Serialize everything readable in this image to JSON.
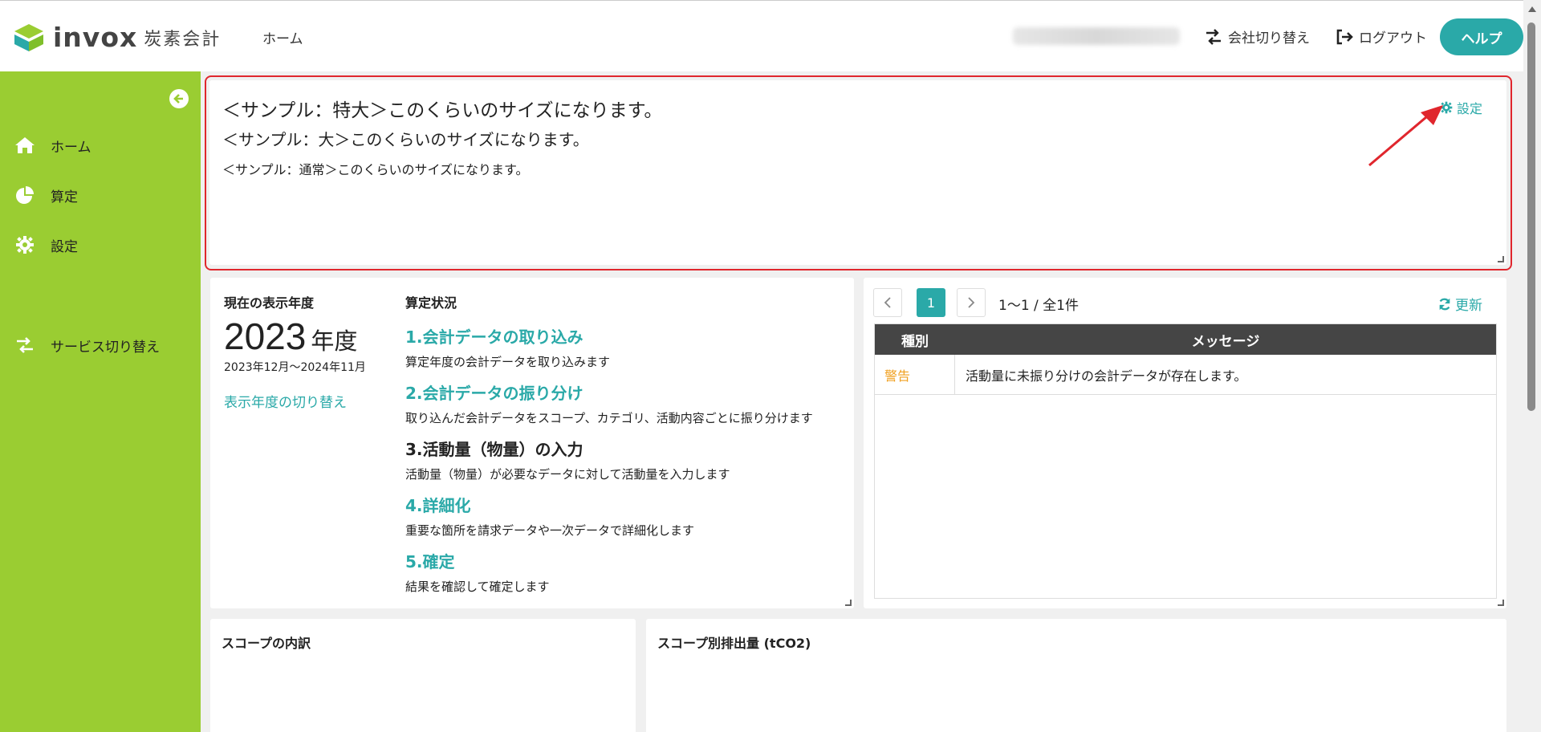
{
  "header": {
    "logo_text": "invox",
    "logo_sub": "炭素会計",
    "nav_home": "ホーム",
    "company_switch": "会社切り替え",
    "logout": "ログアウト",
    "help": "ヘルプ"
  },
  "sidebar": {
    "items": [
      {
        "label": "ホーム",
        "icon": "home-icon"
      },
      {
        "label": "算定",
        "icon": "pie-chart-icon"
      },
      {
        "label": "設定",
        "icon": "gear-icon"
      },
      {
        "label": "サービス切り替え",
        "icon": "switch-icon"
      }
    ]
  },
  "notice": {
    "sample_xl": "＜サンプル：特大＞このくらいのサイズになります。",
    "sample_lg": "＜サンプル：大＞このくらいのサイズになります。",
    "sample_normal": "＜サンプル：通常＞このくらいのサイズになります。",
    "settings_label": "設定"
  },
  "year_panel": {
    "current_label": "現在の表示年度",
    "year": "2023",
    "year_unit": "年度",
    "range": "2023年12月〜2024年11月",
    "switch_link": "表示年度の切り替え",
    "status_label": "算定状況",
    "steps": [
      {
        "title": "1.会計データの取り込み",
        "desc": "算定年度の会計データを取り込みます",
        "color": "#2aa9a8"
      },
      {
        "title": "2.会計データの振り分け",
        "desc": "取り込んだ会計データをスコープ、カテゴリ、活動内容ごとに振り分けます",
        "color": "#2aa9a8"
      },
      {
        "title": "3.活動量（物量）の入力",
        "desc": "活動量（物量）が必要なデータに対して活動量を入力します",
        "color": "#222222"
      },
      {
        "title": "4.詳細化",
        "desc": "重要な箇所を請求データや一次データで詳細化します",
        "color": "#2aa9a8"
      },
      {
        "title": "5.確定",
        "desc": "結果を確認して確定します",
        "color": "#2aa9a8"
      }
    ]
  },
  "messages": {
    "current_page": "1",
    "page_info": "1〜1 / 全1件",
    "refresh": "更新",
    "columns": [
      "種別",
      "メッセージ"
    ],
    "rows": [
      {
        "type": "警告",
        "message": "活動量に未振り分けの会計データが存在します。"
      }
    ]
  },
  "scope_panel": {
    "title": "スコープの内訳"
  },
  "emission_panel": {
    "title": "スコープ別排出量 (tCO2)"
  },
  "colors": {
    "accent": "#2aa9a8",
    "sidebar": "#9acd32",
    "warning": "#f0a020",
    "highlight": "#e0262d"
  }
}
